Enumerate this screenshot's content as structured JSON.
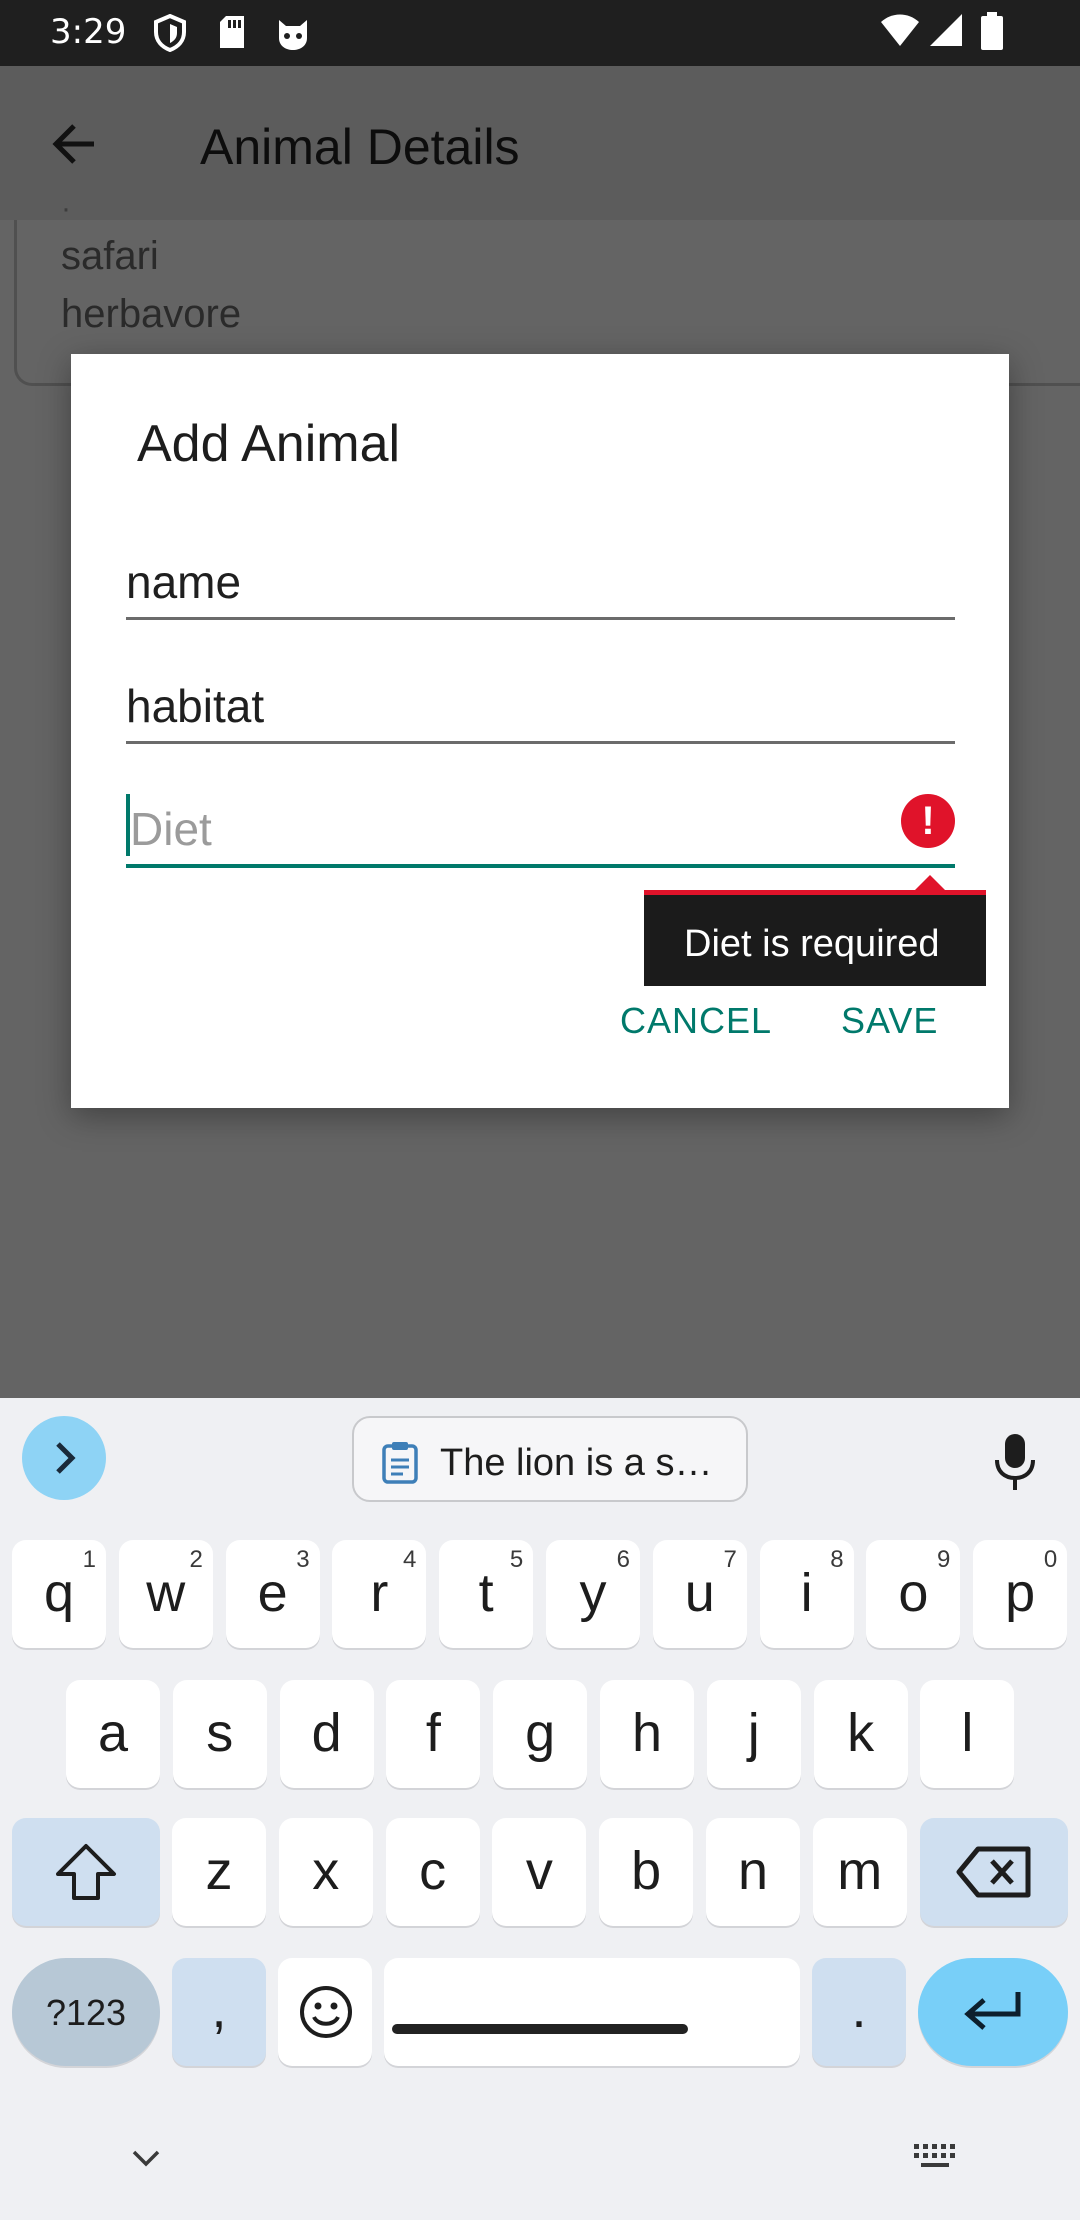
{
  "status_bar": {
    "time": "3:29",
    "left_icons": [
      "shield-icon",
      "sd-card-icon",
      "cat-icon"
    ],
    "right_icons": [
      "wifi-icon",
      "signal-icon",
      "battery-icon"
    ]
  },
  "app_bar": {
    "title": "Animal Details",
    "back_icon": "arrow-left-icon"
  },
  "background_card": {
    "lines": [
      "safari",
      "herbavore"
    ]
  },
  "dialog": {
    "title": "Add Animal",
    "fields": {
      "name": "name",
      "habitat": "habitat",
      "diet_placeholder": "Diet"
    },
    "error_tooltip": "Diet is required",
    "cancel_label": "CANCEL",
    "save_label": "SAVE",
    "accent_color": "#00796b",
    "error_color": "#e0132a"
  },
  "keyboard": {
    "suggestion_clip": "The lion is a s…",
    "row1": [
      {
        "c": "q",
        "n": "1"
      },
      {
        "c": "w",
        "n": "2"
      },
      {
        "c": "e",
        "n": "3"
      },
      {
        "c": "r",
        "n": "4"
      },
      {
        "c": "t",
        "n": "5"
      },
      {
        "c": "y",
        "n": "6"
      },
      {
        "c": "u",
        "n": "7"
      },
      {
        "c": "i",
        "n": "8"
      },
      {
        "c": "o",
        "n": "9"
      },
      {
        "c": "p",
        "n": "0"
      }
    ],
    "row2": [
      "a",
      "s",
      "d",
      "f",
      "g",
      "h",
      "j",
      "k",
      "l"
    ],
    "row3": [
      "z",
      "x",
      "c",
      "v",
      "b",
      "n",
      "m"
    ],
    "symbols_label": "?123",
    "comma": ",",
    "period": "."
  }
}
